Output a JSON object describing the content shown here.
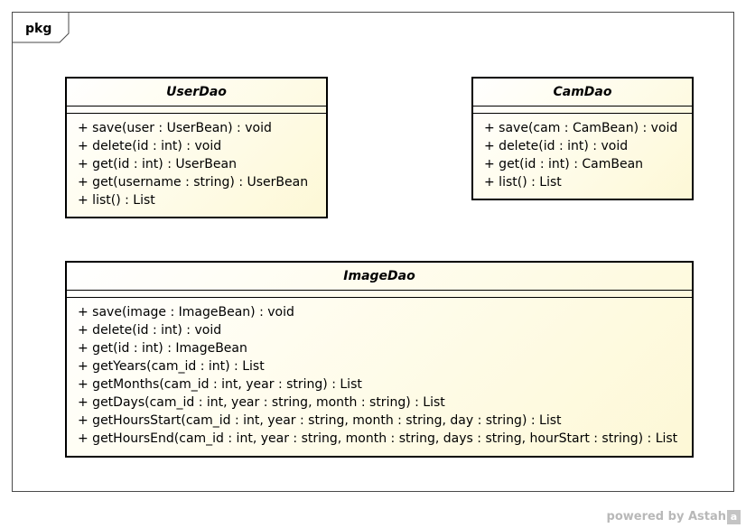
{
  "package": {
    "label": "pkg"
  },
  "classes": {
    "userdao": {
      "name": "UserDao",
      "operations": [
        "+ save(user : UserBean) : void",
        "+ delete(id : int) : void",
        "+ get(id : int) : UserBean",
        "+ get(username : string) : UserBean",
        "+ list() : List"
      ]
    },
    "camdao": {
      "name": "CamDao",
      "operations": [
        "+ save(cam : CamBean) : void",
        "+ delete(id : int) : void",
        "+ get(id : int) : CamBean",
        "+ list() : List"
      ]
    },
    "imagedao": {
      "name": "ImageDao",
      "operations": [
        "+ save(image : ImageBean) : void",
        "+ delete(id : int) : void",
        "+ get(id : int) : ImageBean",
        "+ getYears(cam_id : int) : List",
        "+ getMonths(cam_id : int, year : string) : List",
        "+ getDays(cam_id : int, year : string, month : string) : List",
        "+ getHoursStart(cam_id : int, year : string, month : string, day : string) : List",
        "+ getHoursEnd(cam_id : int, year : string, month : string, days : string, hourStart : string) : List"
      ]
    }
  },
  "watermark": {
    "text": "powered by Astah",
    "logo": "a"
  }
}
